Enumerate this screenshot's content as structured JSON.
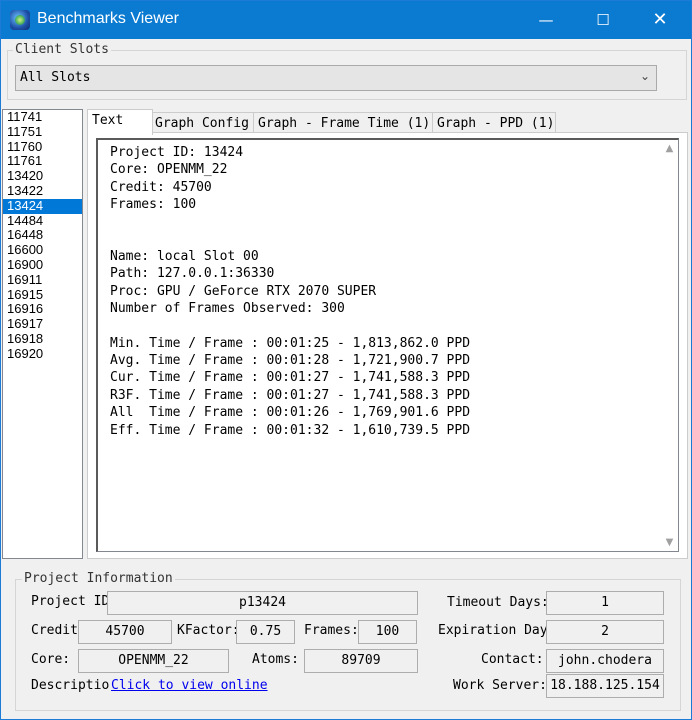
{
  "window": {
    "title": "Benchmarks Viewer",
    "minimize": "—",
    "maximize": "☐",
    "close": "✕",
    "app_icon": "folding-globe-icon"
  },
  "client_slots": {
    "legend": "Client Slots",
    "selected": "All Slots",
    "arrow": "⌄"
  },
  "project_list": {
    "items": [
      "11741",
      "11751",
      "11760",
      "11761",
      "13420",
      "13422",
      "13424",
      "14484",
      "16448",
      "16600",
      "16900",
      "16911",
      "16915",
      "16916",
      "16917",
      "16918",
      "16920"
    ],
    "selected": "13424"
  },
  "tabs": [
    "Text",
    "Graph Config",
    "Graph - Frame Time (1)",
    "Graph - PPD (1)"
  ],
  "active_tab": "Text",
  "text_output": "Project ID: 13424\nCore: OPENMM_22\nCredit: 45700\nFrames: 100\n\n\nName: local Slot 00\nPath: 127.0.0.1:36330\nProc: GPU / GeForce RTX 2070 SUPER\nNumber of Frames Observed: 300\n\nMin. Time / Frame : 00:01:25 - 1,813,862.0 PPD\nAvg. Time / Frame : 00:01:28 - 1,721,900.7 PPD\nCur. Time / Frame : 00:01:27 - 1,741,588.3 PPD\nR3F. Time / Frame : 00:01:27 - 1,741,588.3 PPD\nAll  Time / Frame : 00:01:26 - 1,769,901.6 PPD\nEff. Time / Frame : 00:01:32 - 1,610,739.5 PPD",
  "scroll": {
    "up": "▲",
    "down": "▼"
  },
  "project_info": {
    "legend": "Project Information",
    "project_id_label": "Project ID",
    "project_id": "p13424",
    "credit_label": "Credit",
    "credit": "45700",
    "kfactor_label": "KFactor:",
    "kfactor": "0.75",
    "frames_label": "Frames:",
    "frames": "100",
    "core_label": "Core:",
    "core": "OPENMM_22",
    "atoms_label": "Atoms:",
    "atoms": "89709",
    "description_label": "Descriptio",
    "description_link": "Click to view online",
    "timeout_label": "Timeout Days:",
    "timeout_days": "1",
    "expiration_label": "Expiration Days",
    "expiration_days": "2",
    "contact_label": "Contact:",
    "contact": "john.chodera",
    "work_server_label": "Work Server:",
    "work_server": "18.188.125.154"
  }
}
